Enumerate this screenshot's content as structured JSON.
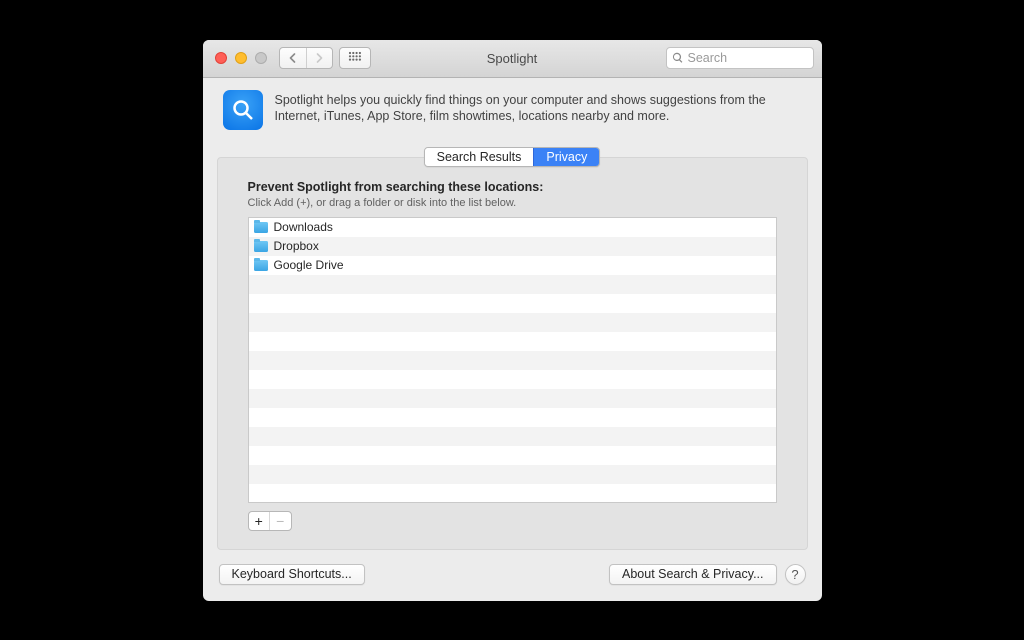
{
  "window": {
    "title": "Spotlight",
    "search_placeholder": "Search"
  },
  "header": {
    "description": "Spotlight helps you quickly find things on your computer and shows suggestions from the Internet, iTunes, App Store, film showtimes, locations nearby and more."
  },
  "tabs": {
    "search_results": "Search Results",
    "privacy": "Privacy",
    "selected": "privacy"
  },
  "panel": {
    "heading": "Prevent Spotlight from searching these locations:",
    "hint": "Click Add (+), or drag a folder or disk into the list below.",
    "locations": [
      "Downloads",
      "Dropbox",
      "Google Drive"
    ]
  },
  "footer": {
    "keyboard_shortcuts": "Keyboard Shortcuts...",
    "about": "About Search & Privacy...",
    "help": "?"
  },
  "icons": {
    "back": "‹",
    "forward": "›",
    "add": "+",
    "remove": "−"
  }
}
